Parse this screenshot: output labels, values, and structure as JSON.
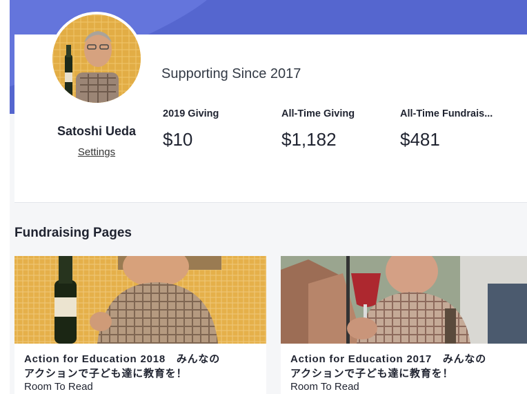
{
  "profile": {
    "name": "Satoshi Ueda",
    "settings_label": "Settings",
    "supporting_since": "Supporting Since 2017"
  },
  "stats": [
    {
      "label": "2019 Giving",
      "value": "$10"
    },
    {
      "label": "All-Time Giving",
      "value": "$1,182"
    },
    {
      "label": "All-Time Fundrais...",
      "value": "$481"
    }
  ],
  "fundraising": {
    "title": "Fundraising Pages",
    "pages": [
      {
        "title": "Action for Education 2018　みんなの\nアクションで子ども達に教育を！",
        "org": "Room To Read"
      },
      {
        "title": "Action for Education 2017　みんなの\nアクションで子ども達に教育を！",
        "org": "Room To Read"
      }
    ]
  },
  "colors": {
    "banner": "#5566cf",
    "accent_gold": "#e6a93f"
  }
}
